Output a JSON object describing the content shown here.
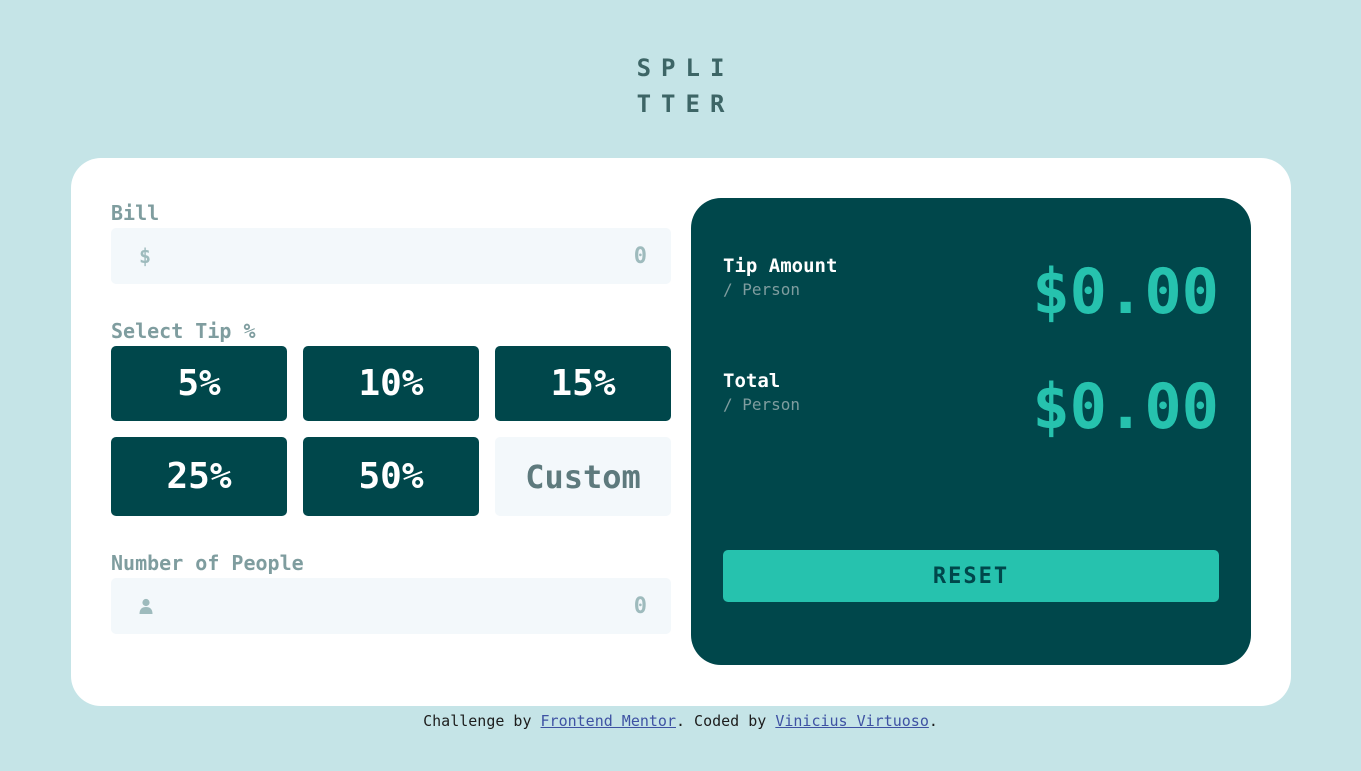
{
  "logo": {
    "line1": "SPLI",
    "line2": "TTER"
  },
  "bill": {
    "label": "Bill",
    "currency_symbol": "$",
    "placeholder": "0"
  },
  "tip": {
    "label": "Select Tip %",
    "options": [
      "5%",
      "10%",
      "15%",
      "25%",
      "50%"
    ],
    "custom_label": "Custom"
  },
  "people": {
    "label": "Number of People",
    "placeholder": "0"
  },
  "summary": {
    "tip_label": "Tip Amount",
    "tip_sub": "/ Person",
    "tip_value": "$0.00",
    "total_label": "Total",
    "total_sub": "/ Person",
    "total_value": "$0.00",
    "reset_label": "RESET"
  },
  "attribution": {
    "prefix": "Challenge by",
    "link1": "Frontend Mentor",
    "middle": ". Coded by",
    "link2": "Vinicius Virtuoso",
    "suffix": "."
  },
  "colors": {
    "background": "#c5e4e7",
    "dark_cyan": "#00474b",
    "accent": "#26c2ae",
    "input_bg": "#f3f8fb"
  }
}
